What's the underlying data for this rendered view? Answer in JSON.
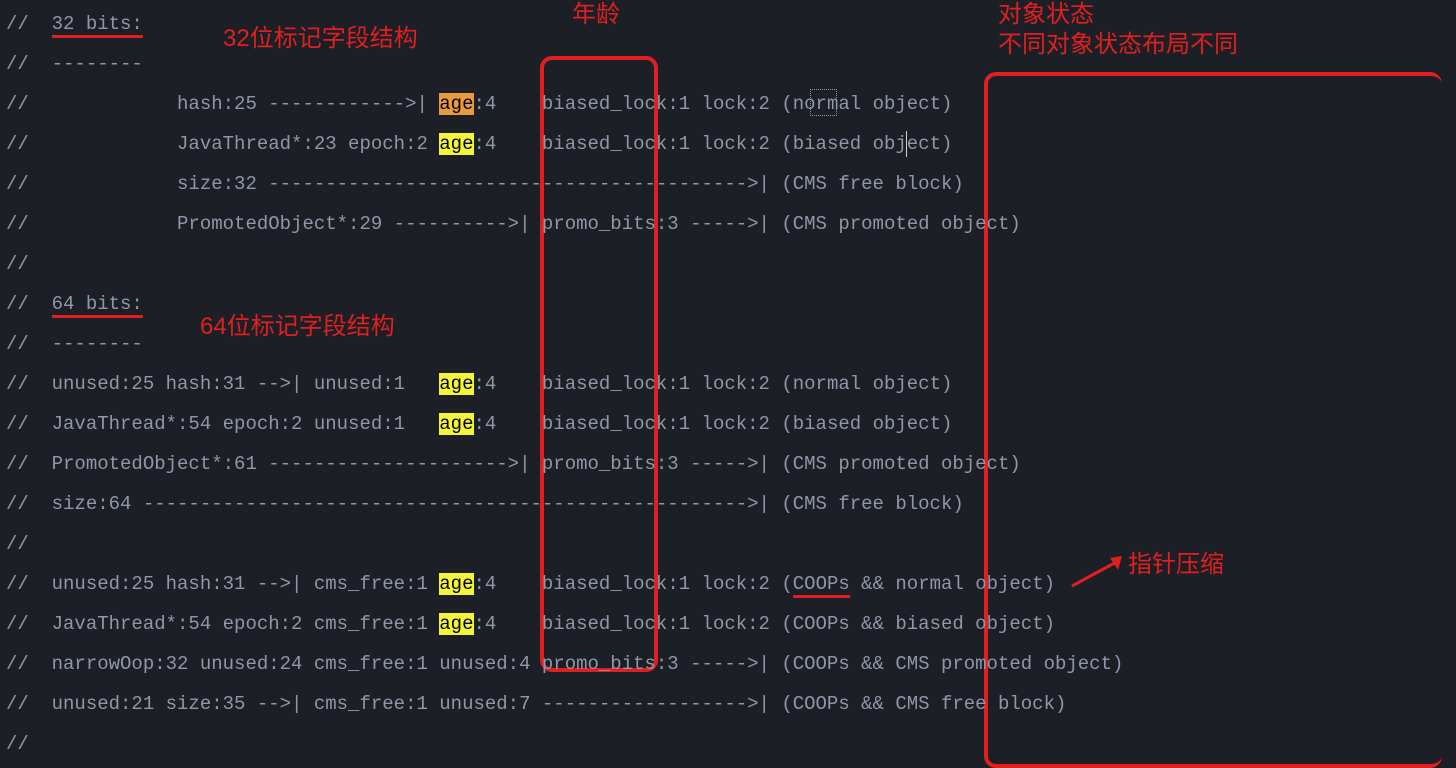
{
  "annotations": {
    "age_header": "年龄",
    "state_header_l1": "对象状态",
    "state_header_l2": "不同对象状态布局不同",
    "label_32": "32位标记字段结构",
    "label_64": "64位标记字段结构",
    "pointer_compress": "指针压缩"
  },
  "tokens": {
    "age": "age",
    "coops": "COOPs"
  },
  "lines": {
    "l0": {
      "pre": "//  32 bits:"
    },
    "l1": {
      "pre": "//  --------"
    },
    "l2": {
      "pre": "//             hash:25 ------------>| ",
      "after_age": ":4    biased_lock:1 lock:2 (normal object)"
    },
    "l3": {
      "pre": "//             JavaThread*:23 epoch:2 ",
      "after_age": ":4    biased_lock:1 lock:2 (biased object)"
    },
    "l4": {
      "pre": "//             size:32 ------------------------------------------>| (CMS free block)"
    },
    "l5": {
      "pre": "//             PromotedObject*:29 ---------->| promo_bits:3 ----->| (CMS promoted object)"
    },
    "l6": {
      "pre": "//"
    },
    "l7": {
      "pre": "//  64 bits:"
    },
    "l8": {
      "pre": "//  --------"
    },
    "l9": {
      "pre": "//  unused:25 hash:31 -->| unused:1   ",
      "after_age": ":4    biased_lock:1 lock:2 (normal object)"
    },
    "l10": {
      "pre": "//  JavaThread*:54 epoch:2 unused:1   ",
      "after_age": ":4    biased_lock:1 lock:2 (biased object)"
    },
    "l11": {
      "pre": "//  PromotedObject*:61 --------------------->| promo_bits:3 ----->| (CMS promoted object)"
    },
    "l12": {
      "pre": "//  size:64 ----------------------------------------------------->| (CMS free block)"
    },
    "l13": {
      "pre": "//"
    },
    "l14": {
      "pre": "//  unused:25 hash:31 -->| cms_free:1 ",
      "after_age": ":4    biased_lock:1 lock:2 (",
      "after_coops": " && normal object)"
    },
    "l15": {
      "pre": "//  JavaThread*:54 epoch:2 cms_free:1 ",
      "after_age": ":4    biased_lock:1 lock:2 (COOPs && biased object)"
    },
    "l16": {
      "pre": "//  narrowOop:32 unused:24 cms_free:1 unused:4 promo_bits:3 ----->| (COOPs && CMS promoted object)"
    },
    "l17": {
      "pre": "//  unused:21 size:35 -->| cms_free:1 unused:7 ------------------>| (COOPs && CMS free block)"
    },
    "l18": {
      "pre": "//"
    }
  },
  "colors": {
    "highlight_orange": "#e89a3c",
    "highlight_yellow": "#f4f43a",
    "annotation_red": "#e02020",
    "bg": "#1c1f26",
    "text": "#8f97a8"
  }
}
